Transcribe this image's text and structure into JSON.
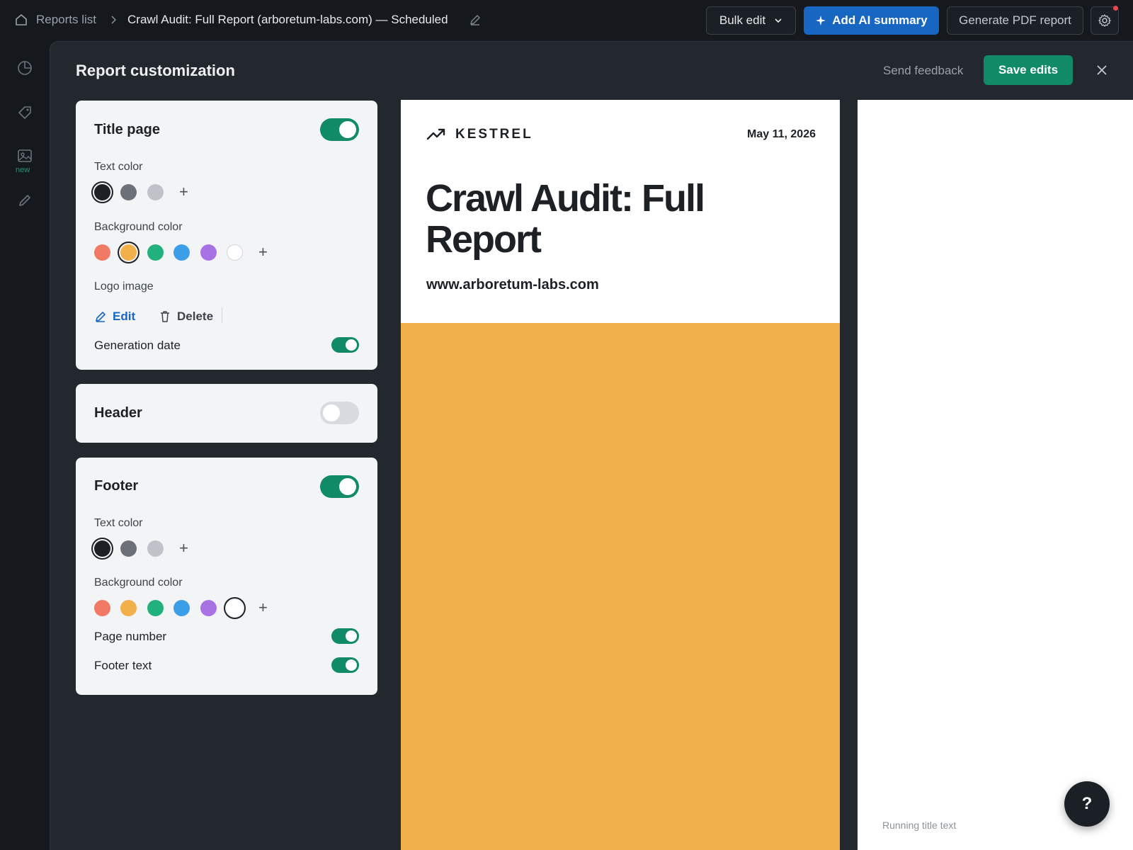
{
  "topbar": {
    "home_icon": "home-icon",
    "breadcrumb_link": "Reports list",
    "report_title": "Crawl Audit: Full Report (arboretum-labs.com) — Scheduled",
    "bulk_edit_label": "Bulk edit",
    "ai_summary_label": "Add AI summary",
    "generate_pdf_label": "Generate PDF report",
    "settings_icon": "gear-icon",
    "accent_blue": "#1766c2"
  },
  "rail": {
    "items": [
      {
        "icon": "pie-chart-icon"
      },
      {
        "icon": "tag-icon",
        "badge": "new"
      },
      {
        "icon": "image-icon"
      },
      {
        "icon": "pencil-icon"
      }
    ]
  },
  "panel": {
    "title": "Report customization",
    "send_feedback": "Send feedback",
    "save_label": "Save edits",
    "accent_green": "#118a68"
  },
  "title_page": {
    "heading": "Title page",
    "enabled": true,
    "text_color_label": "Text color",
    "text_colors": [
      "#1d2126",
      "#6b7079",
      "#bfc3c9"
    ],
    "text_color_selected": 0,
    "background_color_label": "Background color",
    "background_colors": [
      "#f07a64",
      "#f2b04b",
      "#22b07d",
      "#3d9ee8",
      "#a972e4",
      "#ffffff"
    ],
    "background_color_selected": 1,
    "logo_label": "Logo image",
    "edit_label": "Edit",
    "delete_label": "Delete",
    "generation_date_label": "Generation date",
    "generation_date_enabled": true
  },
  "header": {
    "heading": "Header",
    "enabled": false
  },
  "footer": {
    "heading": "Footer",
    "enabled": true,
    "text_color_label": "Text color",
    "text_color_selected": 0,
    "background_color_label": "Background color",
    "background_color_selected": 5,
    "page_number_label": "Page number",
    "page_number_enabled": true,
    "footer_text_label": "Footer text",
    "footer_text_enabled": true
  },
  "preview": {
    "brand": "KESTREL",
    "date": "May 11, 2026",
    "title": "Crawl Audit: Full Report",
    "url": "www.arboretum-labs.com",
    "band_color": "#f2b04b",
    "running_title": "Running title text"
  },
  "help_label": "?"
}
